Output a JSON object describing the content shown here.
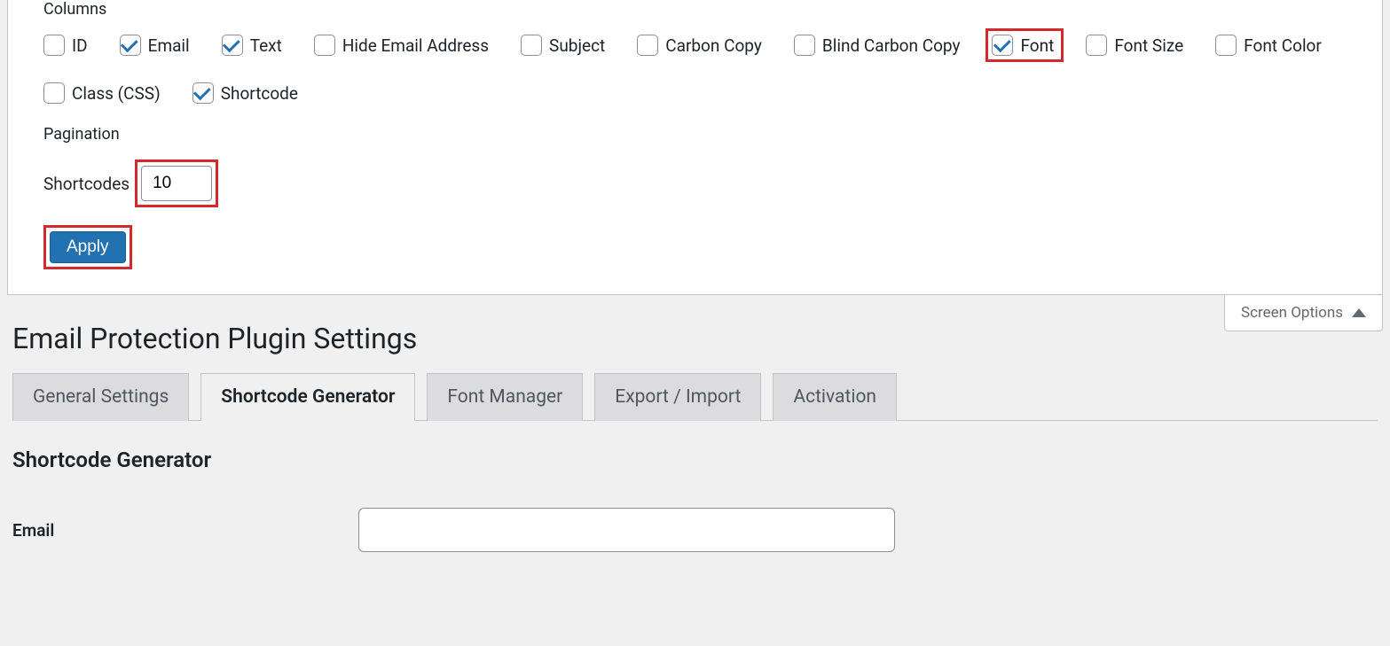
{
  "columns": {
    "label": "Columns",
    "items": [
      {
        "key": "id",
        "label": "ID",
        "checked": false,
        "highlight": false
      },
      {
        "key": "email",
        "label": "Email",
        "checked": true,
        "highlight": false
      },
      {
        "key": "text",
        "label": "Text",
        "checked": true,
        "highlight": false
      },
      {
        "key": "hide_email",
        "label": "Hide Email Address",
        "checked": false,
        "highlight": false
      },
      {
        "key": "subject",
        "label": "Subject",
        "checked": false,
        "highlight": false
      },
      {
        "key": "carbon_copy",
        "label": "Carbon Copy",
        "checked": false,
        "highlight": false
      },
      {
        "key": "blind_carbon_copy",
        "label": "Blind Carbon Copy",
        "checked": false,
        "highlight": false
      },
      {
        "key": "font",
        "label": "Font",
        "checked": true,
        "highlight": true
      },
      {
        "key": "font_size",
        "label": "Font Size",
        "checked": false,
        "highlight": false
      },
      {
        "key": "font_color",
        "label": "Font Color",
        "checked": false,
        "highlight": false
      },
      {
        "key": "class_css",
        "label": "Class (CSS)",
        "checked": false,
        "highlight": false
      },
      {
        "key": "shortcode",
        "label": "Shortcode",
        "checked": true,
        "highlight": false
      }
    ]
  },
  "pagination": {
    "label": "Pagination",
    "field_label": "Shortcodes",
    "value": "10"
  },
  "apply_label": "Apply",
  "screen_options_label": "Screen Options",
  "page_title": "Email Protection Plugin Settings",
  "tabs": [
    {
      "key": "general",
      "label": "General Settings",
      "active": false
    },
    {
      "key": "shortcode_gen",
      "label": "Shortcode Generator",
      "active": true
    },
    {
      "key": "font_manager",
      "label": "Font Manager",
      "active": false
    },
    {
      "key": "export_import",
      "label": "Export / Import",
      "active": false
    },
    {
      "key": "activation",
      "label": "Activation",
      "active": false
    }
  ],
  "section_heading": "Shortcode Generator",
  "form": {
    "email_label": "Email",
    "email_value": ""
  }
}
